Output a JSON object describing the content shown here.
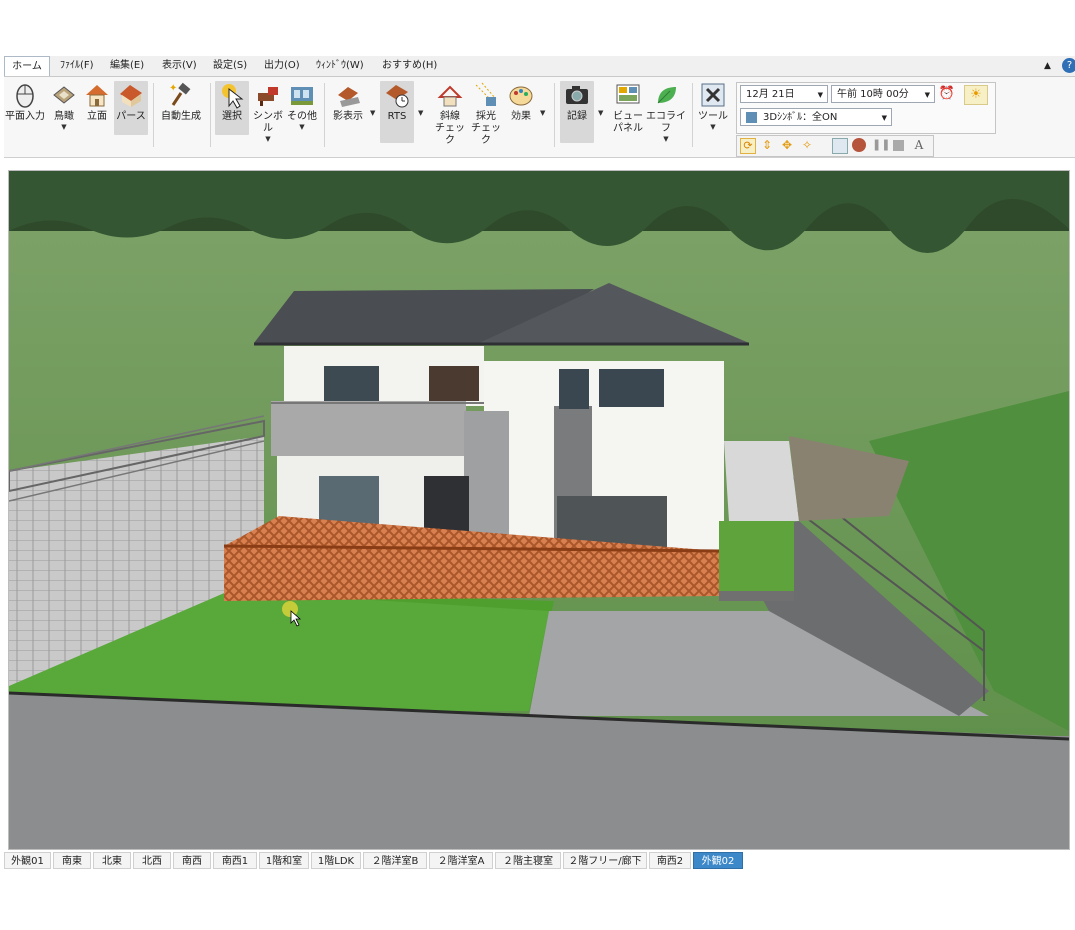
{
  "menu": {
    "tabs": [
      "ホーム",
      "ﾌｧｲﾙ(F)",
      "編集(E)",
      "表示(V)",
      "設定(S)",
      "出力(O)",
      "ｳｨﾝﾄﾞｳ(W)",
      "おすすめ(H)"
    ]
  },
  "ribbon": {
    "plan_input": "平面入力",
    "birdseye": "鳥瞰",
    "elevation": "立面",
    "perspective": "パース",
    "auto_generate": "自動生成",
    "select": "選択",
    "symbol": "シンボル",
    "other": "その他",
    "shadow": "影表示",
    "rts": "RTS",
    "slant_line": "斜線",
    "slant_check": "チェック",
    "daylight": "採光",
    "daylight_check": "チェック",
    "effect": "効果",
    "record": "記録",
    "view": "ビュー",
    "panel": "パネル",
    "eco_life": "エコライフ",
    "tool": "ツール",
    "date_value": "12月 21日",
    "time_value": "午前 10時 00分",
    "symbol_mode": "3Dｼﾝﾎﾞﾙ：全ON"
  },
  "view_tabs": [
    "外観01",
    "南東",
    "北東",
    "北西",
    "南西",
    "南西1",
    "1階和室",
    "1階LDK",
    "２階洋室B",
    "２階洋室A",
    "２階主寝室",
    "２階フリー/廊下",
    "南西2",
    "外観02"
  ],
  "active_view_tab": "外観02",
  "colors": {
    "accent": "#3c88c8",
    "sky": "#2d7a2d",
    "grass": "#5ca63a",
    "road": "#8b8d8f",
    "wall": "#f3f3f0",
    "roof": "#4a4d52",
    "deck": "#c0643a"
  }
}
